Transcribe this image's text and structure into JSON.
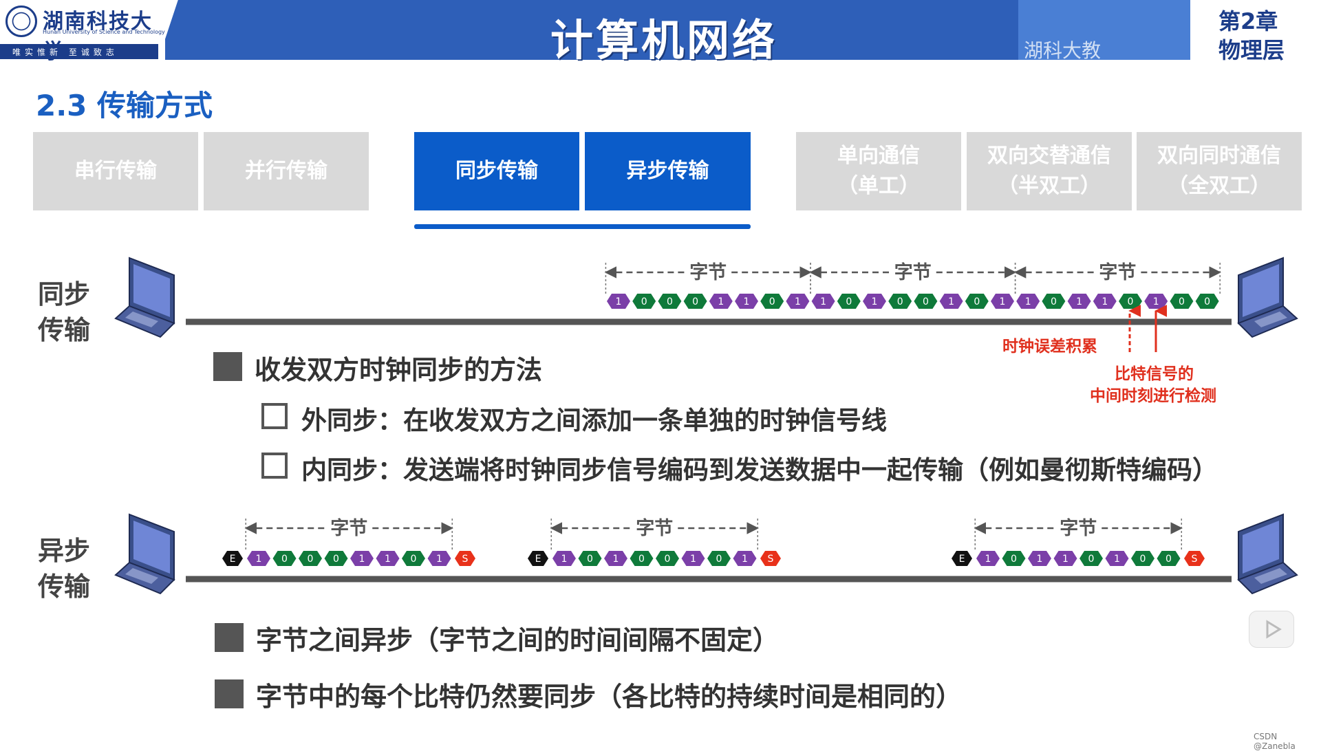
{
  "header": {
    "logo_name": "湖南科技大学",
    "logo_en": "Hunan University of Science and Technology",
    "logo_motto": "唯实惟新 至诚致志",
    "course_title": "计算机网络",
    "watermark": "湖科大教",
    "chapter": "第2章",
    "chapter_sub": "物理层"
  },
  "section_title": "2.3 传输方式",
  "tabs": [
    {
      "label": "串行传输",
      "active": false
    },
    {
      "label": "并行传输",
      "active": false
    },
    {
      "label": "同步传输",
      "active": true
    },
    {
      "label": "异步传输",
      "active": true
    },
    {
      "label": "单向通信",
      "label2": "（单工）",
      "active": false
    },
    {
      "label": "双向交替通信",
      "label2": "（半双工）",
      "active": false
    },
    {
      "label": "双向同时通信",
      "label2": "（全双工）",
      "active": false
    }
  ],
  "sync": {
    "label_line1": "同步",
    "label_line2": "传输",
    "byte_label": "字节",
    "bits": [
      "1",
      "0",
      "0",
      "0",
      "1",
      "1",
      "0",
      "1",
      "1",
      "0",
      "1",
      "0",
      "0",
      "1",
      "0",
      "1",
      "1",
      "0",
      "1",
      "1",
      "0",
      "1",
      "0",
      "0"
    ],
    "annot_clock_error": "时钟误差积累",
    "annot_mid1": "比特信号的",
    "annot_mid2": "中间时刻进行检测",
    "bullet_main": "收发双方时钟同步的方法",
    "sub1": "外同步：在收发双方之间添加一条单独的时钟信号线",
    "sub2": "内同步：发送端将时钟同步信号编码到发送数据中一起传输（例如曼彻斯特编码）"
  },
  "async": {
    "label_line1": "异步",
    "label_line2": "传输",
    "byte_label": "字节",
    "start_marker": "E",
    "stop_marker": "S",
    "frames": [
      [
        "1",
        "0",
        "0",
        "0",
        "1",
        "1",
        "0",
        "1"
      ],
      [
        "1",
        "0",
        "1",
        "0",
        "0",
        "1",
        "0",
        "1"
      ],
      [
        "1",
        "0",
        "1",
        "1",
        "0",
        "1",
        "0",
        "0"
      ]
    ],
    "bullet1": "字节之间异步（字节之间的时间间隔不固定）",
    "bullet2": "字节中的每个比特仍然要同步（各比特的持续时间是相同的）"
  },
  "colors": {
    "bit_one": "#7b3fa8",
    "bit_zero": "#0f7a3a",
    "start": "#111111",
    "stop": "#e8311a",
    "accent": "#0b5cc9"
  },
  "footer": {
    "credit": "CSDN @Zanebla"
  }
}
